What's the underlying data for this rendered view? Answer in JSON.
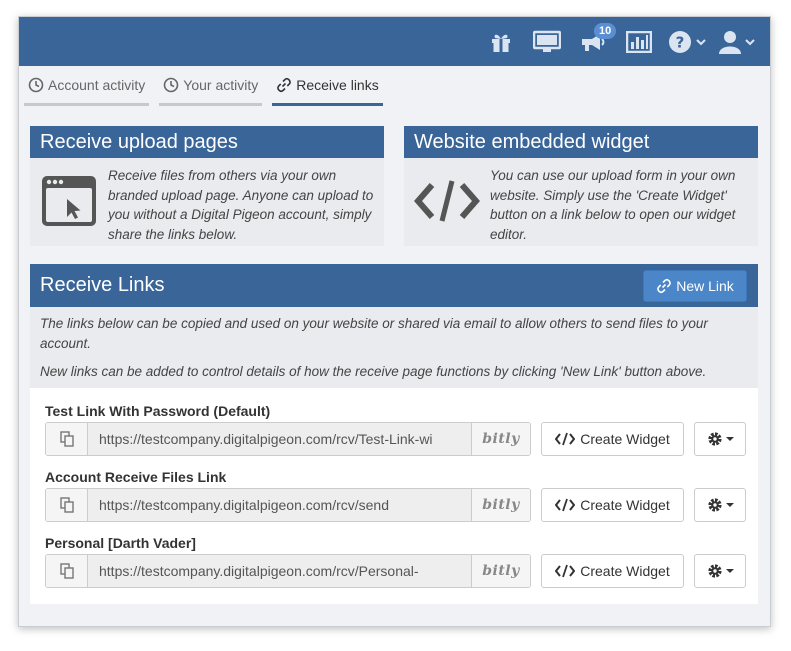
{
  "topbar": {
    "icons": [
      "gift-icon",
      "monitor-icon",
      "megaphone-icon",
      "bar-chart-icon",
      "help-icon",
      "user-icon"
    ],
    "notification_count": "10"
  },
  "tabs": [
    {
      "label": "Account activity",
      "icon": "clock-icon"
    },
    {
      "label": "Your activity",
      "icon": "clock-icon"
    },
    {
      "label": "Receive links",
      "icon": "link-icon",
      "active": true
    }
  ],
  "cards": {
    "upload": {
      "title": "Receive upload pages",
      "text": "Receive files from others via your own branded upload page. Anyone can upload to you without a Digital Pigeon account, simply share the links below."
    },
    "widget": {
      "title": "Website embedded widget",
      "text": "You can use our upload form in your own website. Simply use the 'Create Widget' button on a link below to open our widget editor."
    }
  },
  "receive_links": {
    "title": "Receive Links",
    "new_link_label": "New Link",
    "desc1": "The links below can be copied and used on your website or shared via email to allow others to send files to your account.",
    "desc2": "New links can be added to control details of how the receive page functions by clicking 'New Link' button above.",
    "bitly_label": "bitly",
    "widget_label": "Create Widget",
    "items": [
      {
        "name": "Test Link With Password (Default)",
        "url": "https://testcompany.digitalpigeon.com/rcv/Test-Link-wi"
      },
      {
        "name": "Account Receive Files Link",
        "url": "https://testcompany.digitalpigeon.com/rcv/send"
      },
      {
        "name": "Personal [Darth Vader]",
        "url": "https://testcompany.digitalpigeon.com/rcv/Personal-"
      }
    ]
  },
  "colors": {
    "header_blue": "#3a6599",
    "button_blue": "#4a86c8",
    "panel_bg": "#e9ebee"
  }
}
